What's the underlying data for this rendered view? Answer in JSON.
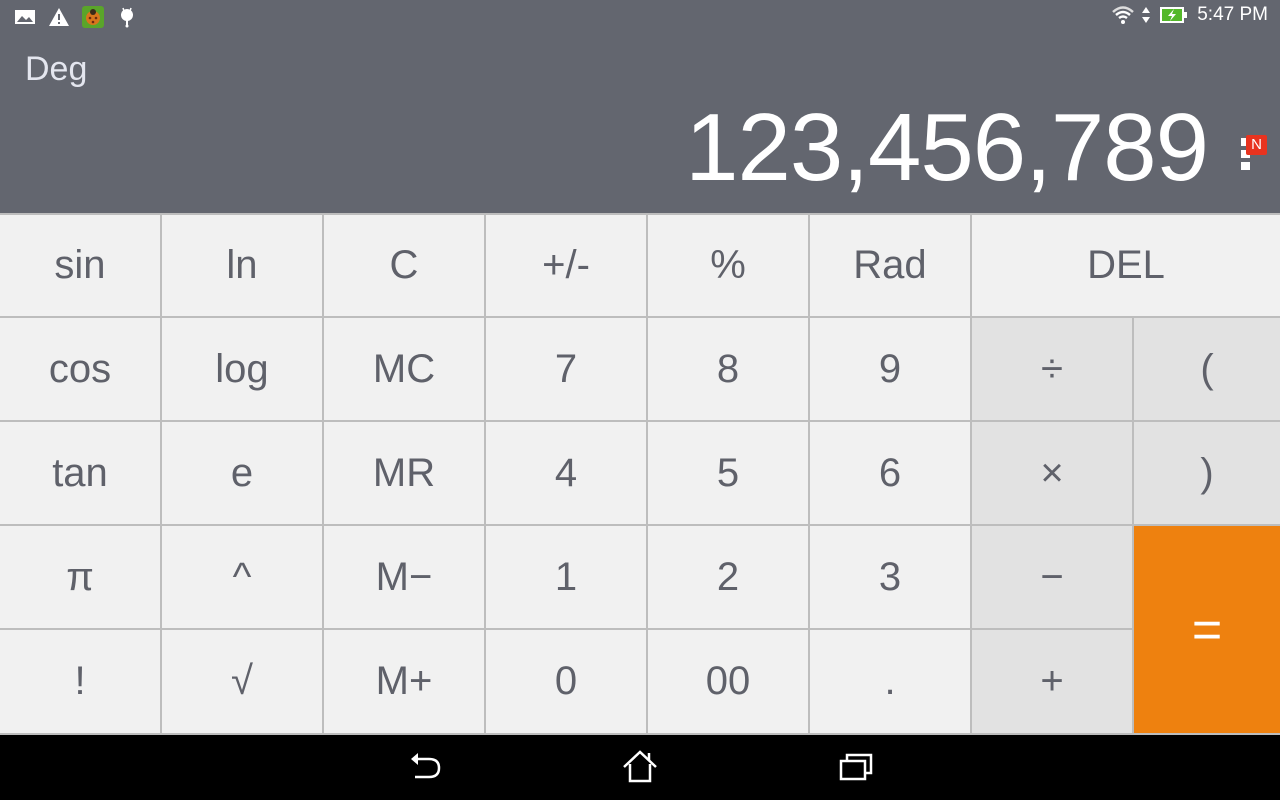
{
  "status_bar": {
    "left_icons": [
      "gallery-icon",
      "warning-icon",
      "bug-app-icon",
      "android-debug-icon"
    ],
    "right_icons": [
      "wifi-icon",
      "data-transfer-icon",
      "battery-charging-icon"
    ],
    "time": "5:47 PM"
  },
  "display": {
    "angle_mode": "Deg",
    "result": "123,456,789",
    "menu_badge": "N"
  },
  "keypad": {
    "rows": [
      [
        "sin",
        "ln",
        "C",
        "+/-",
        "%",
        "Rad",
        "DEL"
      ],
      [
        "cos",
        "log",
        "MC",
        "7",
        "8",
        "9",
        "÷",
        "("
      ],
      [
        "tan",
        "e",
        "MR",
        "4",
        "5",
        "6",
        "×",
        ")"
      ],
      [
        "π",
        "^",
        "M−",
        "1",
        "2",
        "3",
        "−",
        "="
      ],
      [
        "!",
        "√",
        "M+",
        "0",
        "00",
        ".",
        "+"
      ]
    ]
  },
  "colors": {
    "header_bg": "#63666f",
    "key_bg": "#f1f1f1",
    "operator_bg": "#e2e2e2",
    "equals_bg": "#ee810f",
    "key_text": "#5f616a",
    "badge": "#e8331f"
  },
  "nav_bar": {
    "buttons": [
      "back",
      "home",
      "recent-apps"
    ]
  }
}
